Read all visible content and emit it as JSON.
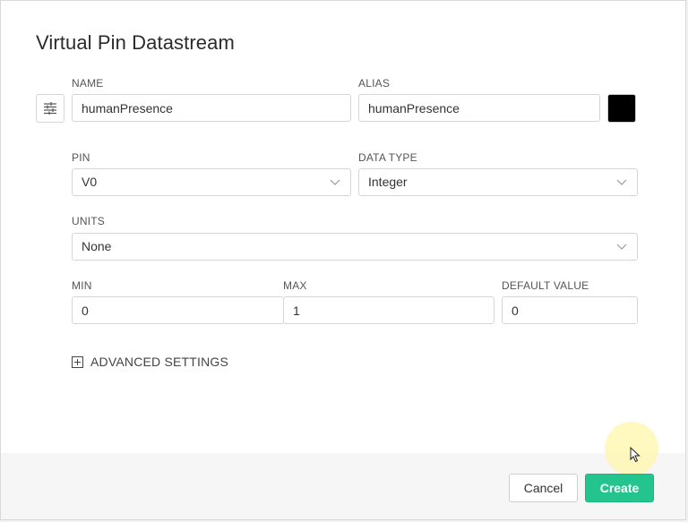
{
  "dialog": {
    "title": "Virtual Pin Datastream"
  },
  "name": {
    "label": "NAME",
    "value": "humanPresence"
  },
  "alias": {
    "label": "ALIAS",
    "value": "humanPresence"
  },
  "color": {
    "value": "#000000"
  },
  "pin": {
    "label": "PIN",
    "selected": "V0"
  },
  "data_type": {
    "label": "DATA TYPE",
    "selected": "Integer"
  },
  "units": {
    "label": "UNITS",
    "selected": "None"
  },
  "min": {
    "label": "MIN",
    "value": "0"
  },
  "max": {
    "label": "MAX",
    "value": "1"
  },
  "default_value": {
    "label": "DEFAULT VALUE",
    "value": "0"
  },
  "advanced": {
    "label": "ADVANCED SETTINGS"
  },
  "footer": {
    "cancel_label": "Cancel",
    "create_label": "Create"
  },
  "icons": {
    "settings": "sliders-icon",
    "chevron": "chevron-down-icon",
    "expand": "plus-square-icon",
    "cursor": "mouse-pointer-icon"
  },
  "colors": {
    "accent": "#23c48e"
  }
}
